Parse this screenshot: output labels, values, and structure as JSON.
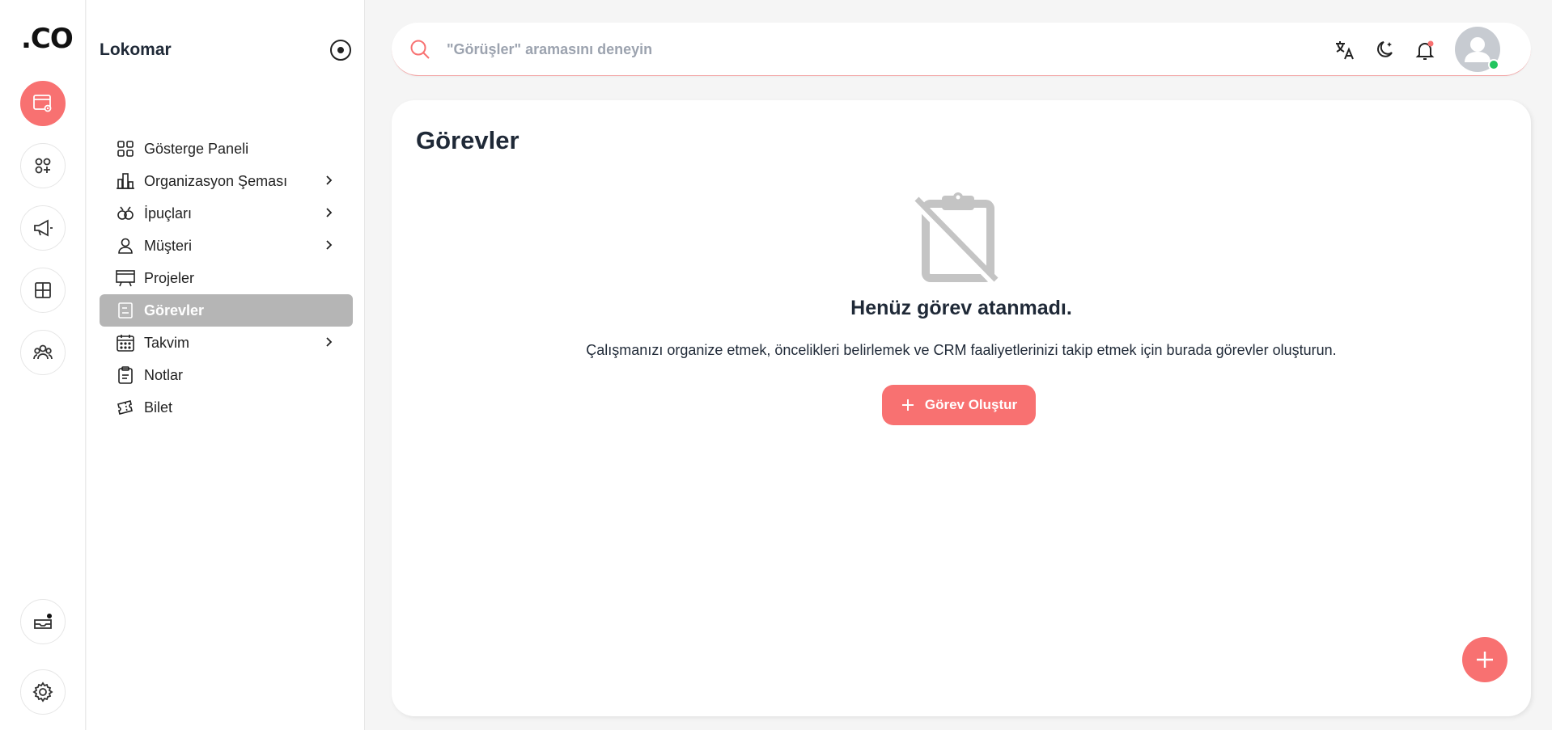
{
  "app": {
    "logo": ".CO"
  },
  "rail": {
    "items": [
      {
        "name": "workspace-settings-icon",
        "active": true
      },
      {
        "name": "apps-add-icon",
        "active": false
      },
      {
        "name": "megaphone-icon",
        "active": false
      },
      {
        "name": "grid-icon",
        "active": false
      },
      {
        "name": "team-icon",
        "active": false
      },
      {
        "name": "inbox-notification-icon",
        "active": false
      },
      {
        "name": "settings-gear-icon",
        "active": false
      }
    ]
  },
  "sidebar": {
    "workspace": "Lokomar",
    "items": [
      {
        "label": "Gösterge Paneli",
        "icon": "dashboard-icon",
        "has_children": false
      },
      {
        "label": "Organizasyon Şeması",
        "icon": "org-chart-icon",
        "has_children": true
      },
      {
        "label": "İpuçları",
        "icon": "leads-icon",
        "has_children": true
      },
      {
        "label": "Müşteri",
        "icon": "user-icon",
        "has_children": true
      },
      {
        "label": "Projeler",
        "icon": "presentation-icon",
        "has_children": false
      },
      {
        "label": "Görevler",
        "icon": "task-icon",
        "has_children": false,
        "active": true
      },
      {
        "label": "Takvim",
        "icon": "calendar-icon",
        "has_children": true
      },
      {
        "label": "Notlar",
        "icon": "clipboard-icon",
        "has_children": false
      },
      {
        "label": "Bilet",
        "icon": "ticket-icon",
        "has_children": false
      }
    ]
  },
  "topbar": {
    "search_placeholder": "\"Görüşler\" aramasını deneyin",
    "icons": [
      "translate-icon",
      "dark-mode-icon",
      "notification-bell-icon",
      "user-avatar-icon"
    ]
  },
  "main": {
    "title": "Görevler",
    "empty_title": "Henüz görev atanmadı.",
    "empty_description": "Çalışmanızı organize etmek, öncelikleri belirlemek ve CRM faaliyetlerinizi takip etmek için burada görevler oluşturun.",
    "create_button": "Görev Oluştur"
  },
  "colors": {
    "accent": "#f87171",
    "active_nav": "#b5b5b5",
    "online": "#22c55e"
  }
}
